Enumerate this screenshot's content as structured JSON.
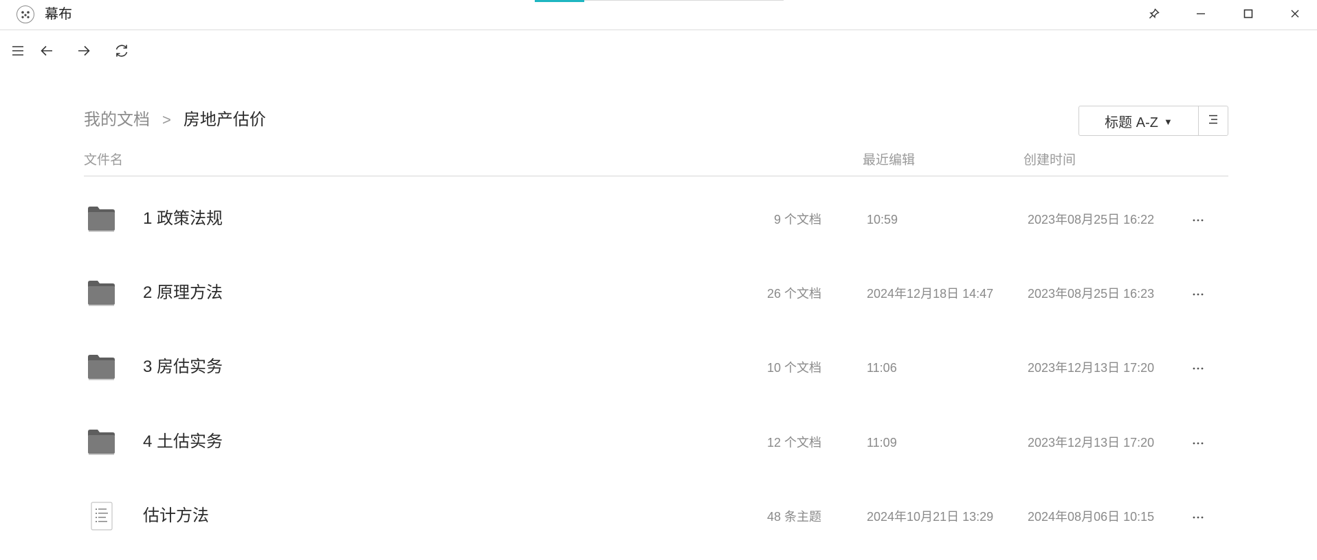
{
  "window": {
    "app_title": "幕布",
    "controls": [
      "pin-icon",
      "minimize-icon",
      "maximize-icon",
      "close-icon"
    ]
  },
  "toolbar": {
    "icons": [
      "menu-icon",
      "back-arrow-icon",
      "forward-arrow-icon",
      "refresh-icon"
    ]
  },
  "breadcrumb": {
    "root": "我的文档",
    "separator": ">",
    "current": "房地产估价"
  },
  "sort": {
    "label": "标题 A-Z",
    "caret": "▾"
  },
  "table": {
    "headers": {
      "name": "文件名",
      "edited": "最近编辑",
      "created": "创建时间"
    },
    "rows": [
      {
        "icon": "folder-icon",
        "name": "1 政策法规",
        "count": "9 个文档",
        "edited": "10:59",
        "created": "2023年08月25日 16:22"
      },
      {
        "icon": "folder-icon",
        "name": "2 原理方法",
        "count": "26 个文档",
        "edited": "2024年12月18日 14:47",
        "created": "2023年08月25日 16:23"
      },
      {
        "icon": "folder-icon",
        "name": "3 房估实务",
        "count": "10 个文档",
        "edited": "11:06",
        "created": "2023年12月13日 17:20"
      },
      {
        "icon": "folder-icon",
        "name": "4 土估实务",
        "count": "12 个文档",
        "edited": "11:09",
        "created": "2023年12月13日 17:20"
      },
      {
        "icon": "document-icon",
        "name": "估计方法",
        "count": "48 条主题",
        "edited": "2024年10月21日 13:29",
        "created": "2024年08月06日 10:15"
      }
    ]
  },
  "colors": {
    "accent": "#1fb6c1",
    "folder": "#7a7a7a",
    "muted_text": "#8a8a8a",
    "divider": "#d6d6d6"
  }
}
